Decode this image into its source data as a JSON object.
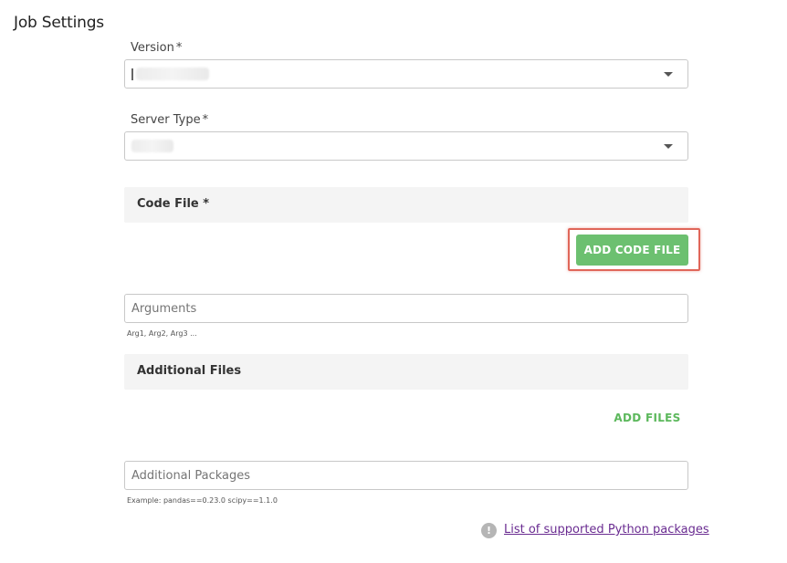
{
  "page": {
    "title": "Job Settings"
  },
  "version": {
    "label": "Version",
    "required_mark": "*"
  },
  "server_type": {
    "label": "Server Type",
    "required_mark": "*"
  },
  "code_file": {
    "header": "Code File *",
    "add_button": "ADD CODE FILE"
  },
  "arguments": {
    "placeholder": "Arguments",
    "hint": "Arg1, Arg2, Arg3 ..."
  },
  "additional_files": {
    "header": "Additional Files",
    "add_button": "ADD FILES"
  },
  "additional_packages": {
    "placeholder": "Additional Packages",
    "hint": "Example: pandas==0.23.0 scipy==1.1.0"
  },
  "supported_packages": {
    "icon_glyph": "!",
    "link_text": "List of supported Python packages"
  },
  "colors": {
    "primary_green": "#6cc070",
    "highlight_red": "#e06659",
    "link_purple": "#6a2c91"
  },
  "icons": {
    "caret": "chevron-down-icon",
    "info": "info-icon"
  }
}
